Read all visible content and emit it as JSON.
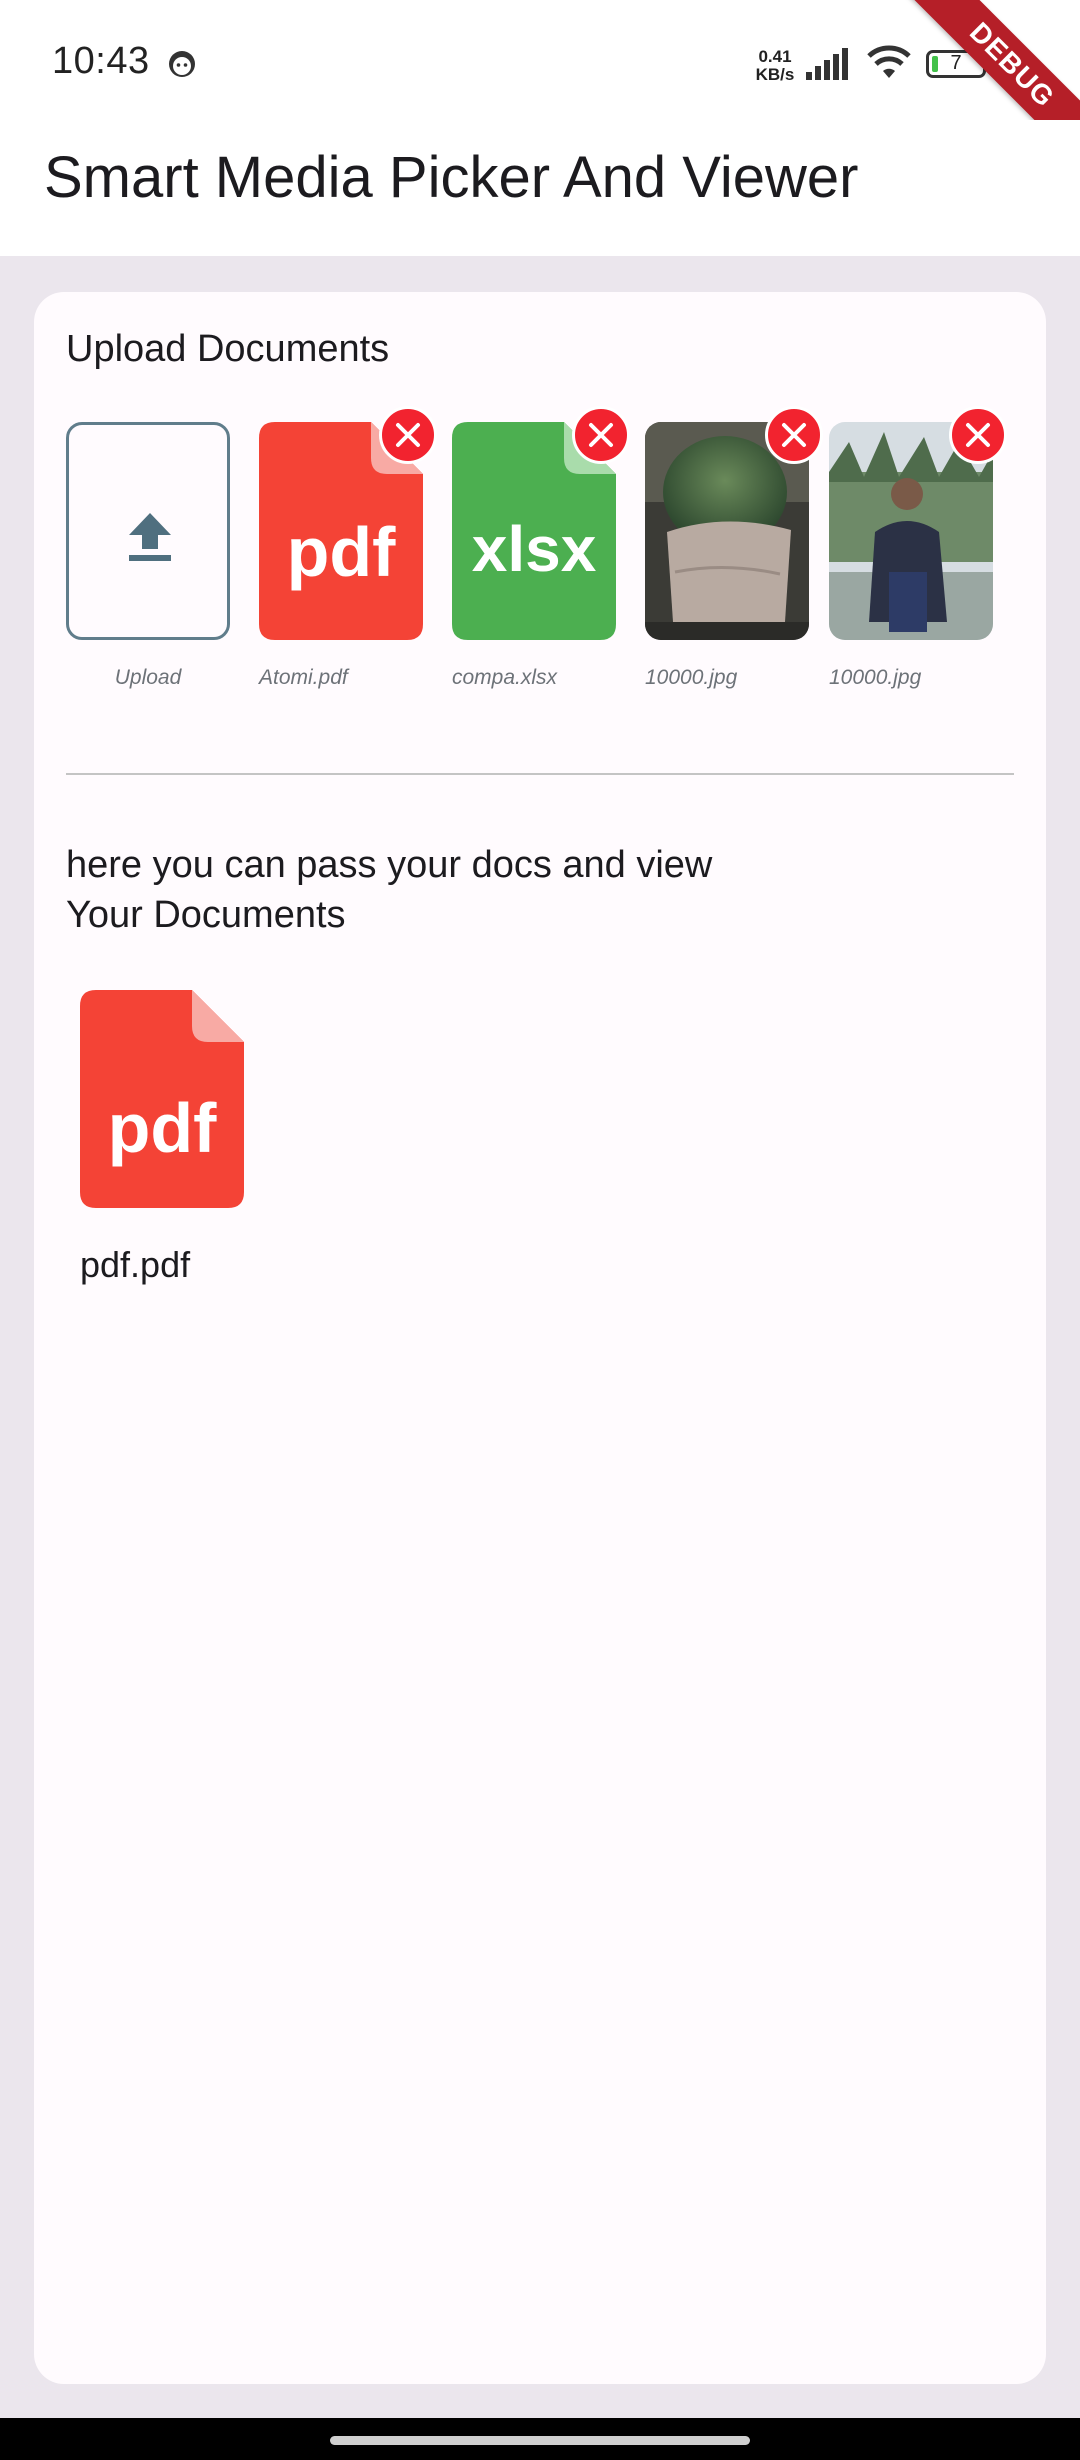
{
  "status_bar": {
    "time": "10:43",
    "net_speed_value": "0.41",
    "net_speed_unit": "KB/s",
    "battery_level": "7"
  },
  "debug_banner": "DEBUG",
  "app_bar": {
    "title": "Smart Media Picker And Viewer"
  },
  "upload_section": {
    "title": "Upload Documents",
    "upload_tile": {
      "icon": "upload-icon",
      "label": "Upload"
    },
    "items": [
      {
        "kind": "file",
        "ext": "pdf",
        "name": "Atomi.pdf",
        "color": "#f44336",
        "remove_icon": "close-icon"
      },
      {
        "kind": "file",
        "ext": "xlsx",
        "name": "compa.xlsx",
        "color": "#4caf50",
        "remove_icon": "close-icon"
      },
      {
        "kind": "image",
        "name": "10000.jpg",
        "remove_icon": "close-icon"
      },
      {
        "kind": "image",
        "name": "10000.jpg",
        "remove_icon": "close-icon"
      }
    ]
  },
  "view_section": {
    "description_line1": "here you can pass your docs and view",
    "description_line2": "Your Documents",
    "document": {
      "ext": "pdf",
      "name": "pdf.pdf",
      "color": "#f44336"
    }
  },
  "colors": {
    "pdf_red": "#f44336",
    "xlsx_green": "#4caf50",
    "remove_red": "#f2232f",
    "upload_border": "#607d8b",
    "background": "#ebe6ed"
  }
}
